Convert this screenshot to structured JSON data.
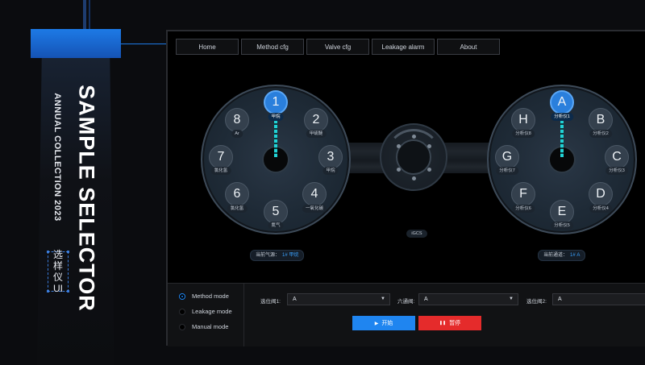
{
  "poster": {
    "title": "SAMPLE SELECTOR",
    "subtitle": "ANNUAL COLLECTION 2023",
    "cn_chars": [
      "选",
      "样",
      "仪",
      "UI"
    ]
  },
  "nav": {
    "tabs": [
      {
        "label": "Home",
        "active": true
      },
      {
        "label": "Method  cfg",
        "active": false
      },
      {
        "label": "Valve  cfg",
        "active": false
      },
      {
        "label": "Leakage  alarm",
        "active": false
      },
      {
        "label": "About",
        "active": false
      }
    ]
  },
  "left_dial": {
    "ports": [
      {
        "num": "1",
        "label": "甲烷",
        "active": true
      },
      {
        "num": "2",
        "label": "甲硫醚",
        "active": false
      },
      {
        "num": "3",
        "label": "甲烷",
        "active": false
      },
      {
        "num": "4",
        "label": "一氧化碳",
        "active": false
      },
      {
        "num": "5",
        "label": "氮气",
        "active": false
      },
      {
        "num": "6",
        "label": "氯化氢",
        "active": false
      },
      {
        "num": "7",
        "label": "氯化氢",
        "active": false
      },
      {
        "num": "8",
        "label": "Ar",
        "active": false
      }
    ],
    "current_label": "当前气源：",
    "current_value": "1#  甲烷"
  },
  "right_dial": {
    "ports": [
      {
        "num": "A",
        "label": "分析仪1",
        "active": true
      },
      {
        "num": "B",
        "label": "分析仪2",
        "active": false
      },
      {
        "num": "C",
        "label": "分析仪3",
        "active": false
      },
      {
        "num": "D",
        "label": "分析仪4",
        "active": false
      },
      {
        "num": "E",
        "label": "分析仪5",
        "active": false
      },
      {
        "num": "F",
        "label": "分析仪6",
        "active": false
      },
      {
        "num": "G",
        "label": "分析仪7",
        "active": false
      },
      {
        "num": "H",
        "label": "分析仪8",
        "active": false
      }
    ],
    "current_label": "当前通道：",
    "current_value": "1#  A"
  },
  "center_valve": {
    "label": "iGCS"
  },
  "modes": [
    {
      "label": "Method mode",
      "selected": true
    },
    {
      "label": "Leakage mode",
      "selected": false
    },
    {
      "label": "Manual mode",
      "selected": false
    }
  ],
  "selects": [
    {
      "label": "选位阀1:",
      "value": "A"
    },
    {
      "label": "六通阀:",
      "value": "A"
    },
    {
      "label": "选位阀2:",
      "value": "A"
    }
  ],
  "buttons": {
    "start_icon": "▶",
    "start_label": "开始",
    "pause_icon": "❚❚",
    "pause_label": "暂停"
  },
  "colors": {
    "accent": "#1f85f0",
    "danger": "#e52b2b",
    "pointer": "#21d3d6"
  }
}
